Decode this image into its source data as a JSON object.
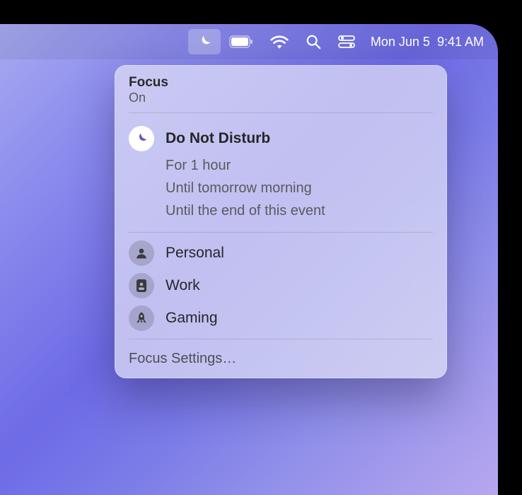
{
  "menubar": {
    "date": "Mon Jun 5",
    "time": "9:41 AM",
    "icons": {
      "focus": "moon-icon",
      "battery": "battery-icon",
      "wifi": "wifi-icon",
      "search": "search-icon",
      "control_center": "control-center-icon"
    }
  },
  "popover": {
    "header": {
      "title": "Focus",
      "status": "On"
    },
    "active_mode": {
      "label": "Do Not Disturb",
      "options": [
        "For 1 hour",
        "Until tomorrow morning",
        "Until the end of this event"
      ]
    },
    "other_modes": [
      {
        "label": "Personal",
        "icon": "person-icon"
      },
      {
        "label": "Work",
        "icon": "id-badge-icon"
      },
      {
        "label": "Gaming",
        "icon": "rocket-icon"
      }
    ],
    "settings_link": "Focus Settings…"
  }
}
